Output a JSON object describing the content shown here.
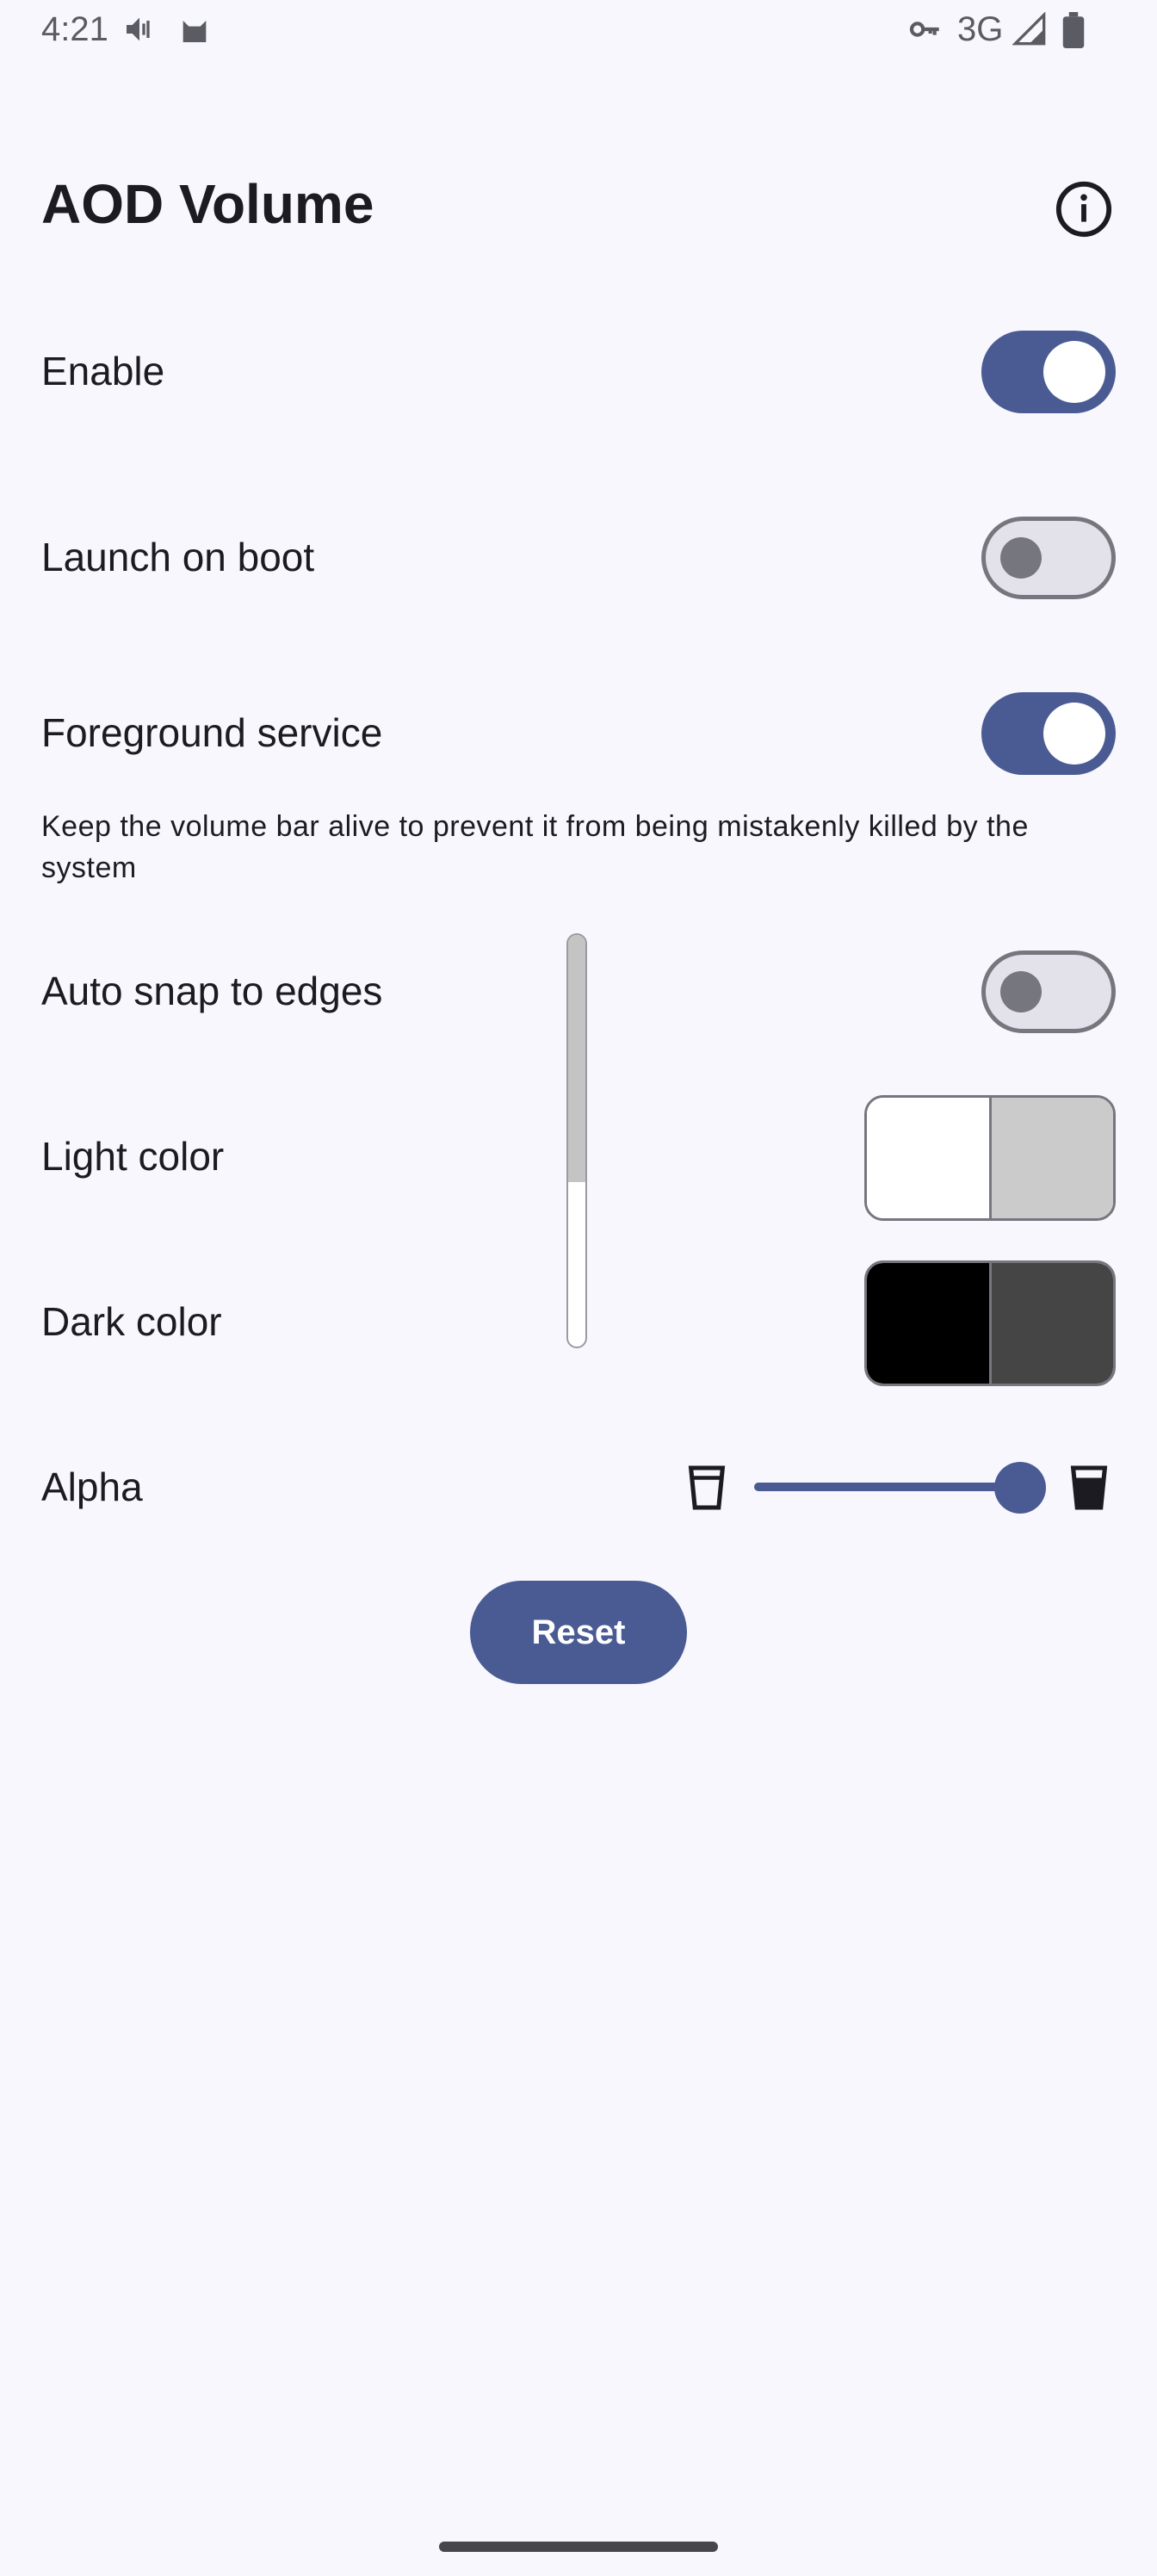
{
  "status_bar": {
    "time": "4:21",
    "network": "3G",
    "icons": [
      "volume-icon",
      "cat-icon",
      "vpn-key-icon",
      "signal-icon",
      "battery-icon"
    ]
  },
  "app": {
    "title": "AOD Volume",
    "info_icon": "info-icon"
  },
  "settings": {
    "enable": {
      "label": "Enable",
      "checked": true
    },
    "launch_on_boot": {
      "label": "Launch on boot",
      "checked": false
    },
    "foreground_service": {
      "label": "Foreground service",
      "checked": true,
      "description": "Keep the volume bar alive to prevent it from being mistakenly killed by the system"
    },
    "auto_snap": {
      "label": "Auto snap to edges",
      "checked": false
    },
    "light_color": {
      "label": "Light color",
      "colors": [
        "#ffffff",
        "#cbcbcb"
      ]
    },
    "dark_color": {
      "label": "Dark color",
      "colors": [
        "#000000",
        "#454545"
      ]
    },
    "alpha": {
      "label": "Alpha",
      "level_fraction": 0.93
    }
  },
  "preview": {
    "level_fraction": 0.6
  },
  "reset_button": {
    "label": "Reset"
  },
  "colors": {
    "accent": "#4a5b94",
    "background": "#f8f7fd",
    "outline": "#76767f"
  }
}
